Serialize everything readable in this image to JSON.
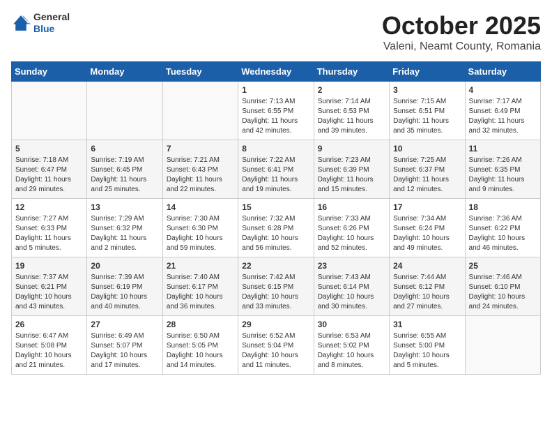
{
  "header": {
    "logo_general": "General",
    "logo_blue": "Blue",
    "month": "October 2025",
    "location": "Valeni, Neamt County, Romania"
  },
  "weekdays": [
    "Sunday",
    "Monday",
    "Tuesday",
    "Wednesday",
    "Thursday",
    "Friday",
    "Saturday"
  ],
  "weeks": [
    [
      {
        "day": "",
        "info": ""
      },
      {
        "day": "",
        "info": ""
      },
      {
        "day": "",
        "info": ""
      },
      {
        "day": "1",
        "info": "Sunrise: 7:13 AM\nSunset: 6:55 PM\nDaylight: 11 hours\nand 42 minutes."
      },
      {
        "day": "2",
        "info": "Sunrise: 7:14 AM\nSunset: 6:53 PM\nDaylight: 11 hours\nand 39 minutes."
      },
      {
        "day": "3",
        "info": "Sunrise: 7:15 AM\nSunset: 6:51 PM\nDaylight: 11 hours\nand 35 minutes."
      },
      {
        "day": "4",
        "info": "Sunrise: 7:17 AM\nSunset: 6:49 PM\nDaylight: 11 hours\nand 32 minutes."
      }
    ],
    [
      {
        "day": "5",
        "info": "Sunrise: 7:18 AM\nSunset: 6:47 PM\nDaylight: 11 hours\nand 29 minutes."
      },
      {
        "day": "6",
        "info": "Sunrise: 7:19 AM\nSunset: 6:45 PM\nDaylight: 11 hours\nand 25 minutes."
      },
      {
        "day": "7",
        "info": "Sunrise: 7:21 AM\nSunset: 6:43 PM\nDaylight: 11 hours\nand 22 minutes."
      },
      {
        "day": "8",
        "info": "Sunrise: 7:22 AM\nSunset: 6:41 PM\nDaylight: 11 hours\nand 19 minutes."
      },
      {
        "day": "9",
        "info": "Sunrise: 7:23 AM\nSunset: 6:39 PM\nDaylight: 11 hours\nand 15 minutes."
      },
      {
        "day": "10",
        "info": "Sunrise: 7:25 AM\nSunset: 6:37 PM\nDaylight: 11 hours\nand 12 minutes."
      },
      {
        "day": "11",
        "info": "Sunrise: 7:26 AM\nSunset: 6:35 PM\nDaylight: 11 hours\nand 9 minutes."
      }
    ],
    [
      {
        "day": "12",
        "info": "Sunrise: 7:27 AM\nSunset: 6:33 PM\nDaylight: 11 hours\nand 5 minutes."
      },
      {
        "day": "13",
        "info": "Sunrise: 7:29 AM\nSunset: 6:32 PM\nDaylight: 11 hours\nand 2 minutes."
      },
      {
        "day": "14",
        "info": "Sunrise: 7:30 AM\nSunset: 6:30 PM\nDaylight: 10 hours\nand 59 minutes."
      },
      {
        "day": "15",
        "info": "Sunrise: 7:32 AM\nSunset: 6:28 PM\nDaylight: 10 hours\nand 56 minutes."
      },
      {
        "day": "16",
        "info": "Sunrise: 7:33 AM\nSunset: 6:26 PM\nDaylight: 10 hours\nand 52 minutes."
      },
      {
        "day": "17",
        "info": "Sunrise: 7:34 AM\nSunset: 6:24 PM\nDaylight: 10 hours\nand 49 minutes."
      },
      {
        "day": "18",
        "info": "Sunrise: 7:36 AM\nSunset: 6:22 PM\nDaylight: 10 hours\nand 46 minutes."
      }
    ],
    [
      {
        "day": "19",
        "info": "Sunrise: 7:37 AM\nSunset: 6:21 PM\nDaylight: 10 hours\nand 43 minutes."
      },
      {
        "day": "20",
        "info": "Sunrise: 7:39 AM\nSunset: 6:19 PM\nDaylight: 10 hours\nand 40 minutes."
      },
      {
        "day": "21",
        "info": "Sunrise: 7:40 AM\nSunset: 6:17 PM\nDaylight: 10 hours\nand 36 minutes."
      },
      {
        "day": "22",
        "info": "Sunrise: 7:42 AM\nSunset: 6:15 PM\nDaylight: 10 hours\nand 33 minutes."
      },
      {
        "day": "23",
        "info": "Sunrise: 7:43 AM\nSunset: 6:14 PM\nDaylight: 10 hours\nand 30 minutes."
      },
      {
        "day": "24",
        "info": "Sunrise: 7:44 AM\nSunset: 6:12 PM\nDaylight: 10 hours\nand 27 minutes."
      },
      {
        "day": "25",
        "info": "Sunrise: 7:46 AM\nSunset: 6:10 PM\nDaylight: 10 hours\nand 24 minutes."
      }
    ],
    [
      {
        "day": "26",
        "info": "Sunrise: 6:47 AM\nSunset: 5:08 PM\nDaylight: 10 hours\nand 21 minutes."
      },
      {
        "day": "27",
        "info": "Sunrise: 6:49 AM\nSunset: 5:07 PM\nDaylight: 10 hours\nand 17 minutes."
      },
      {
        "day": "28",
        "info": "Sunrise: 6:50 AM\nSunset: 5:05 PM\nDaylight: 10 hours\nand 14 minutes."
      },
      {
        "day": "29",
        "info": "Sunrise: 6:52 AM\nSunset: 5:04 PM\nDaylight: 10 hours\nand 11 minutes."
      },
      {
        "day": "30",
        "info": "Sunrise: 6:53 AM\nSunset: 5:02 PM\nDaylight: 10 hours\nand 8 minutes."
      },
      {
        "day": "31",
        "info": "Sunrise: 6:55 AM\nSunset: 5:00 PM\nDaylight: 10 hours\nand 5 minutes."
      },
      {
        "day": "",
        "info": ""
      }
    ]
  ]
}
